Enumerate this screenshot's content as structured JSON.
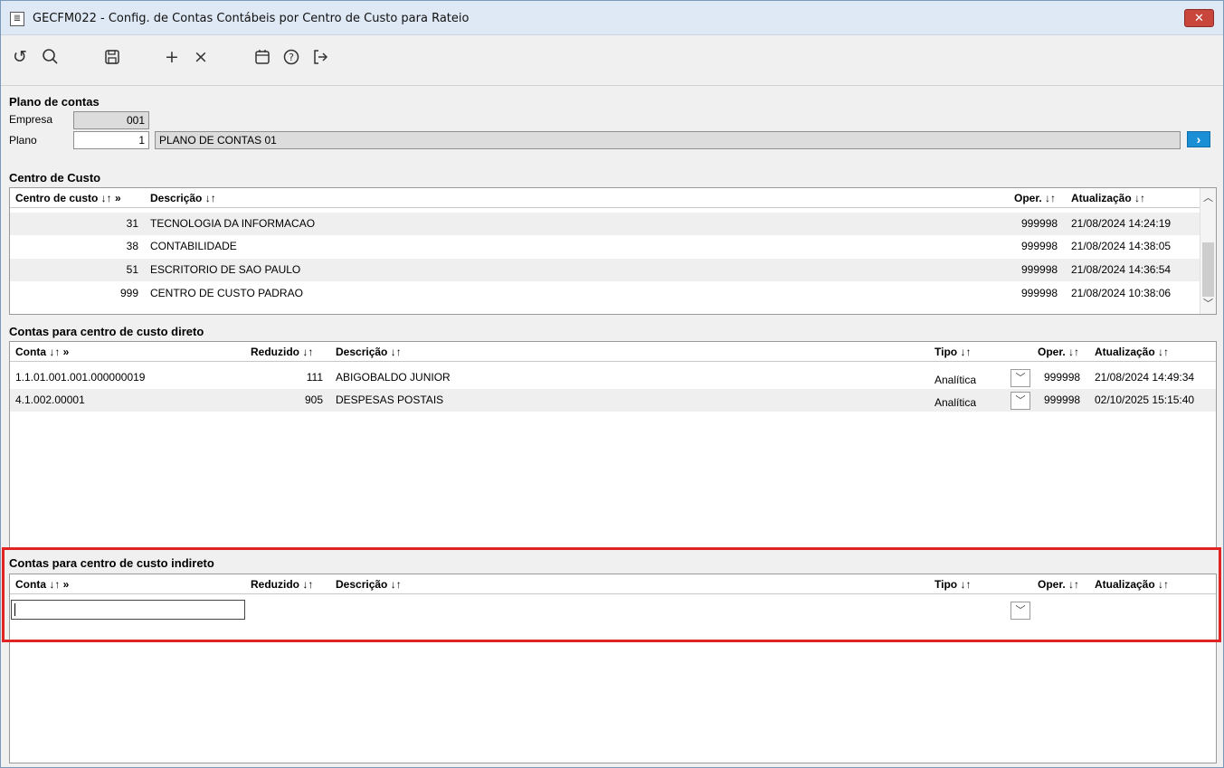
{
  "window": {
    "title": "GECFM022 - Config. de Contas Contábeis por Centro de Custo para Rateio",
    "app_icon": "document-icon",
    "close_glyph": "✕"
  },
  "toolbar": {
    "buttons": [
      {
        "name": "undo",
        "icon": "undo-icon",
        "glyph": "↺"
      },
      {
        "name": "search",
        "icon": "search-icon",
        "glyph": "🔍"
      },
      {
        "name": "save",
        "icon": "save-icon",
        "glyph": "🖫"
      },
      {
        "name": "add",
        "icon": "plus-icon",
        "glyph": "+"
      },
      {
        "name": "delete",
        "icon": "close-icon",
        "glyph": "×"
      },
      {
        "name": "calendar",
        "icon": "calendar-icon",
        "glyph": "📅"
      },
      {
        "name": "help",
        "icon": "help-icon",
        "glyph": "?"
      },
      {
        "name": "exit",
        "icon": "exit-icon",
        "glyph": "↦"
      }
    ]
  },
  "plano": {
    "section_title": "Plano de contas",
    "empresa_label": "Empresa",
    "empresa_value": "001",
    "plano_label": "Plano",
    "plano_value": "1",
    "plano_desc": "PLANO DE CONTAS 01",
    "go_glyph": "›"
  },
  "centro": {
    "section_title": "Centro de Custo",
    "headers": [
      "Centro de custo ↓↑ »",
      "Descrição ↓↑",
      "Oper. ↓↑",
      "Atualização ↓↑"
    ],
    "rows": [
      {
        "code": "31",
        "desc": "TECNOLOGIA DA INFORMACAO",
        "oper": "999998",
        "updated": "21/08/2024 14:24:19"
      },
      {
        "code": "38",
        "desc": "CONTABILIDADE",
        "oper": "999998",
        "updated": "21/08/2024 14:38:05"
      },
      {
        "code": "51",
        "desc": "ESCRITORIO DE SAO PAULO",
        "oper": "999998",
        "updated": "21/08/2024 14:36:54"
      },
      {
        "code": "999",
        "desc": "CENTRO DE CUSTO PADRAO",
        "oper": "999998",
        "updated": "21/08/2024 10:38:06"
      }
    ]
  },
  "direto": {
    "section_title": "Contas para centro de custo direto",
    "headers": [
      "Conta ↓↑ »",
      "Reduzido ↓↑",
      "Descrição ↓↑",
      "Tipo ↓↑",
      "Oper. ↓↑",
      "Atualização ↓↑"
    ],
    "rows": [
      {
        "conta": "1.1.01.001.001.000000019",
        "reduzido": "111",
        "desc": "ABIGOBALDO JUNIOR",
        "tipo": "Analítica",
        "oper": "999998",
        "updated": "21/08/2024 14:49:34"
      },
      {
        "conta": "4.1.002.00001",
        "reduzido": "905",
        "desc": "DESPESAS POSTAIS",
        "tipo": "Analítica",
        "oper": "999998",
        "updated": "02/10/2025 15:15:40"
      }
    ]
  },
  "indireto": {
    "section_title": "Contas para centro de custo indireto",
    "headers": [
      "Conta ↓↑ »",
      "Reduzido ↓↑",
      "Descrição ↓↑",
      "Tipo ↓↑",
      "Oper. ↓↑",
      "Atualização ↓↑"
    ],
    "new_conta_value": ""
  },
  "colors": {
    "highlight_border": "#e02424",
    "go_button": "#1a8fd6",
    "close_button": "#c9463d"
  }
}
